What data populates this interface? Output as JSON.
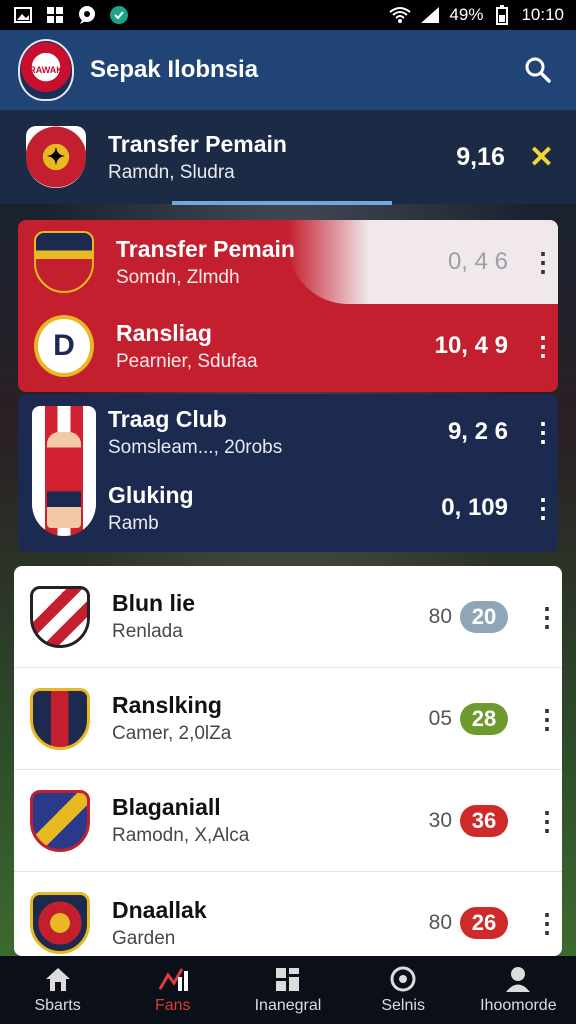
{
  "statusbar": {
    "battery": "49%",
    "time": "10:10",
    "icons": [
      "gallery-icon",
      "grid-icon",
      "chat-icon",
      "check-circle-icon",
      "wifi-icon",
      "signal-icon",
      "battery-icon"
    ]
  },
  "appbar": {
    "logo_text": "RAWAK",
    "title": "Sepak Ilobnsia"
  },
  "pinned": {
    "title": "Transfer Pemain",
    "subtitle": "Ramdn, Sludra",
    "value": "9,16"
  },
  "red_panel": [
    {
      "title": "Transfer Pemain",
      "subtitle": "Somdn, Zlmdh",
      "value": "0, 4 6"
    },
    {
      "title": "Ransliag",
      "subtitle": "Pearnier, Sdufaa",
      "value": "10, 4 9",
      "crest_letter": "D"
    }
  ],
  "navy_panel": [
    {
      "title": "Traag Club",
      "subtitle": "Somsleam..., 20robs",
      "value": "9, 2 6"
    },
    {
      "title": "Gluking",
      "subtitle": "Ramb",
      "value": "0, 109"
    }
  ],
  "list": [
    {
      "title": "Blun lie",
      "subtitle": "Renlada",
      "pre": "80",
      "badge": "20",
      "badge_color": "#8fa6b8"
    },
    {
      "title": "Ranslking",
      "subtitle": "Camer, 2,0lZa",
      "pre": "05",
      "badge": "28",
      "badge_color": "#6f9a2e"
    },
    {
      "title": "Blaganiall",
      "subtitle": "Ramodn, X,Alca",
      "pre": "30",
      "badge": "36",
      "badge_color": "#cf2a2a"
    },
    {
      "title": "Dnaallak",
      "subtitle": "Garden",
      "pre": "80",
      "badge": "26",
      "badge_color": "#cf2a2a"
    }
  ],
  "bottomnav": [
    {
      "label": "Sbarts",
      "icon": "home-icon"
    },
    {
      "label": "Fans",
      "icon": "chart-icon",
      "active": true
    },
    {
      "label": "Inanegral",
      "icon": "grid-icon"
    },
    {
      "label": "Selnis",
      "icon": "target-icon"
    },
    {
      "label": "Ihoomorde",
      "icon": "profile-icon"
    }
  ],
  "colors": {
    "appbar": "#214476",
    "red_panel": "#c41f2e",
    "navy_panel": "#1b2a4e",
    "accent_x": "#f1d634",
    "active_nav": "#e03a3a"
  }
}
